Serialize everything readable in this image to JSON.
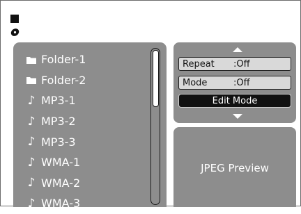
{
  "status_icons": [
    "stop-icon",
    "disc-icon"
  ],
  "file_list": {
    "items": [
      {
        "type": "folder",
        "label": "Folder-1",
        "icon": "folder-icon"
      },
      {
        "type": "folder",
        "label": "Folder-2",
        "icon": "folder-icon"
      },
      {
        "type": "audio",
        "label": "MP3-1",
        "icon": "music-note-icon"
      },
      {
        "type": "audio",
        "label": "MP3-2",
        "icon": "music-note-icon"
      },
      {
        "type": "audio",
        "label": "MP3-3",
        "icon": "music-note-icon"
      },
      {
        "type": "audio",
        "label": "WMA-1",
        "icon": "music-note-icon"
      },
      {
        "type": "audio",
        "label": "WMA-2",
        "icon": "music-note-icon"
      },
      {
        "type": "audio",
        "label": "WMA-3",
        "icon": "music-note-icon"
      }
    ]
  },
  "options": {
    "repeat": {
      "label": "Repeat",
      "value": ":Off"
    },
    "mode": {
      "label": "Mode",
      "value": ":Off"
    },
    "edit_mode": "Edit Mode"
  },
  "preview": {
    "label": "JPEG Preview"
  },
  "colors": {
    "panel": "#8d8d8d",
    "option_row": "#d9d9d9",
    "highlight": "#111111",
    "text_light": "#ffffff"
  }
}
